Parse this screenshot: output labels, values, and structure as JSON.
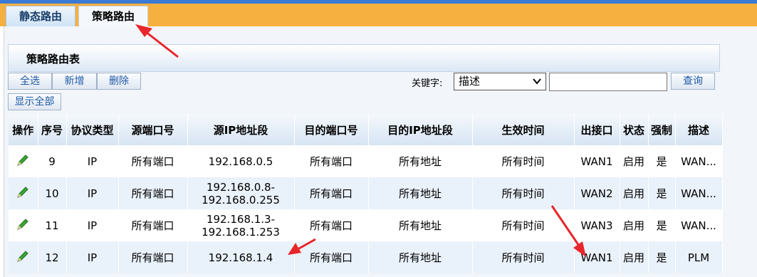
{
  "tabs": [
    {
      "label": "静态路由"
    },
    {
      "label": "策略路由"
    }
  ],
  "section_title": "策略路由表",
  "toolbar": {
    "select_all": "全选",
    "add": "新增",
    "delete": "删除",
    "show_all": "显示全部",
    "keyword_label": "关键字:",
    "keyword_selected": "描述",
    "search_value": "",
    "search_button": "查询"
  },
  "table": {
    "headers": [
      "操作",
      "序号",
      "协议类型",
      "源端口号",
      "源IP地址段",
      "目的端口号",
      "目的IP地址段",
      "生效时间",
      "出接口",
      "状态",
      "强制",
      "描述"
    ],
    "rows": [
      {
        "seq": "9",
        "proto": "IP",
        "src_port": "所有端口",
        "src_ip_1": "192.168.0.5",
        "src_ip_2": "",
        "dst_port": "所有端口",
        "dst_ip": "所有地址",
        "time": "所有时间",
        "iface": "WAN1",
        "status": "启用",
        "force": "是",
        "desc": "WAN..."
      },
      {
        "seq": "10",
        "proto": "IP",
        "src_port": "所有端口",
        "src_ip_1": "192.168.0.8-",
        "src_ip_2": "192.168.0.255",
        "dst_port": "所有端口",
        "dst_ip": "所有地址",
        "time": "所有时间",
        "iface": "WAN2",
        "status": "启用",
        "force": "是",
        "desc": "WAN..."
      },
      {
        "seq": "11",
        "proto": "IP",
        "src_port": "所有端口",
        "src_ip_1": "192.168.1.3-",
        "src_ip_2": "192.168.1.253",
        "dst_port": "所有端口",
        "dst_ip": "所有地址",
        "time": "所有时间",
        "iface": "WAN3",
        "status": "启用",
        "force": "是",
        "desc": "WAN..."
      },
      {
        "seq": "12",
        "proto": "IP",
        "src_port": "所有端口",
        "src_ip_1": "192.168.1.4",
        "src_ip_2": "",
        "dst_port": "所有端口",
        "dst_ip": "所有地址",
        "time": "所有时间",
        "iface": "WAN1",
        "status": "启用",
        "force": "是",
        "desc": "PLM"
      }
    ]
  },
  "icons": {
    "edit": "pencil-icon"
  },
  "colors": {
    "accent_tab_bar": "#f6b040",
    "link_blue": "#1f5aa6",
    "annotation_red": "#e8262a",
    "edit_green": "#3aa635"
  }
}
